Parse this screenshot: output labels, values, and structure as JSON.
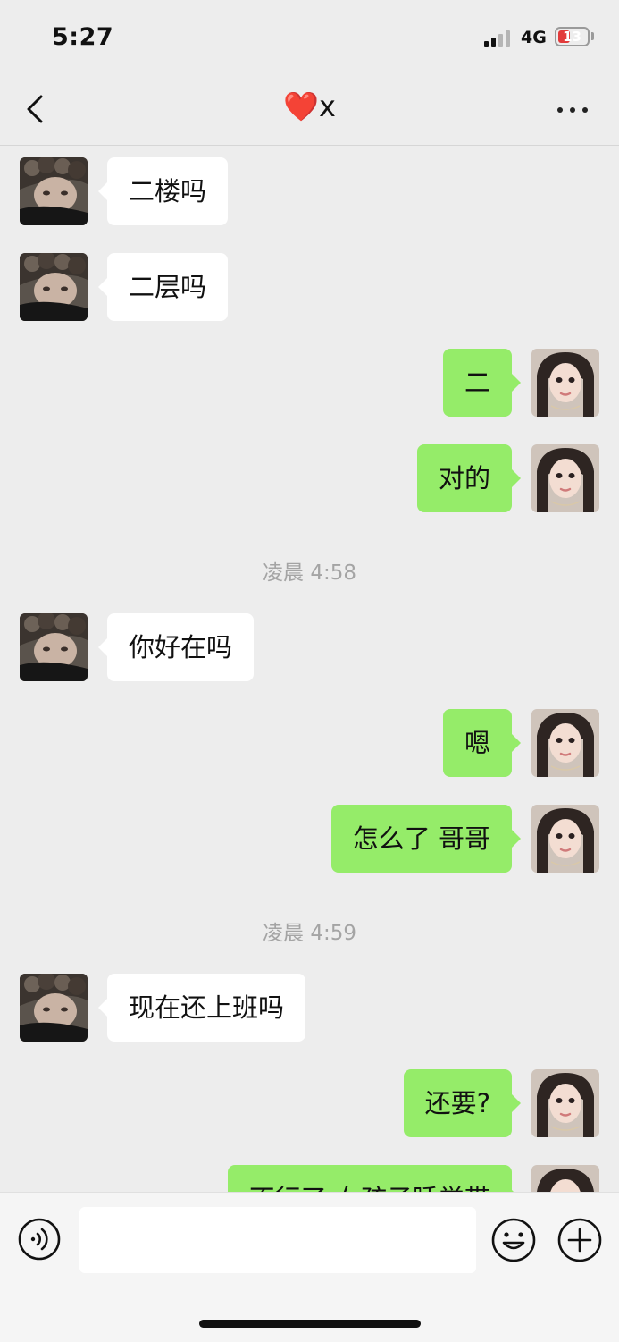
{
  "status_bar": {
    "time": "5:27",
    "network": "4G",
    "battery": "13"
  },
  "header": {
    "title": "❤️x",
    "back_icon": "chevron-left-icon",
    "more_icon": "more-dots-icon"
  },
  "messages": [
    {
      "type": "in",
      "text": "二楼吗"
    },
    {
      "type": "in",
      "text": "二层吗"
    },
    {
      "type": "out",
      "text": "二"
    },
    {
      "type": "out",
      "text": "对的"
    },
    {
      "type": "time",
      "text": "凌晨 4:58"
    },
    {
      "type": "in",
      "text": "你好在吗"
    },
    {
      "type": "out",
      "text": "嗯"
    },
    {
      "type": "out",
      "text": "怎么了 哥哥"
    },
    {
      "type": "time",
      "text": "凌晨 4:59"
    },
    {
      "type": "in",
      "text": "现在还上班吗"
    },
    {
      "type": "out",
      "text": "还要?"
    },
    {
      "type": "out",
      "text": "不行了 女孩子睡觉带"
    }
  ],
  "input_bar": {
    "message_value": "",
    "voice_icon": "voice-icon",
    "emoji_icon": "emoji-icon",
    "plus_icon": "plus-icon"
  },
  "colors": {
    "background": "#ededed",
    "incoming_bubble": "#ffffff",
    "outgoing_bubble": "#95ec69",
    "timestamp_text": "#a4a4a4",
    "battery_low": "#e23b3b"
  }
}
